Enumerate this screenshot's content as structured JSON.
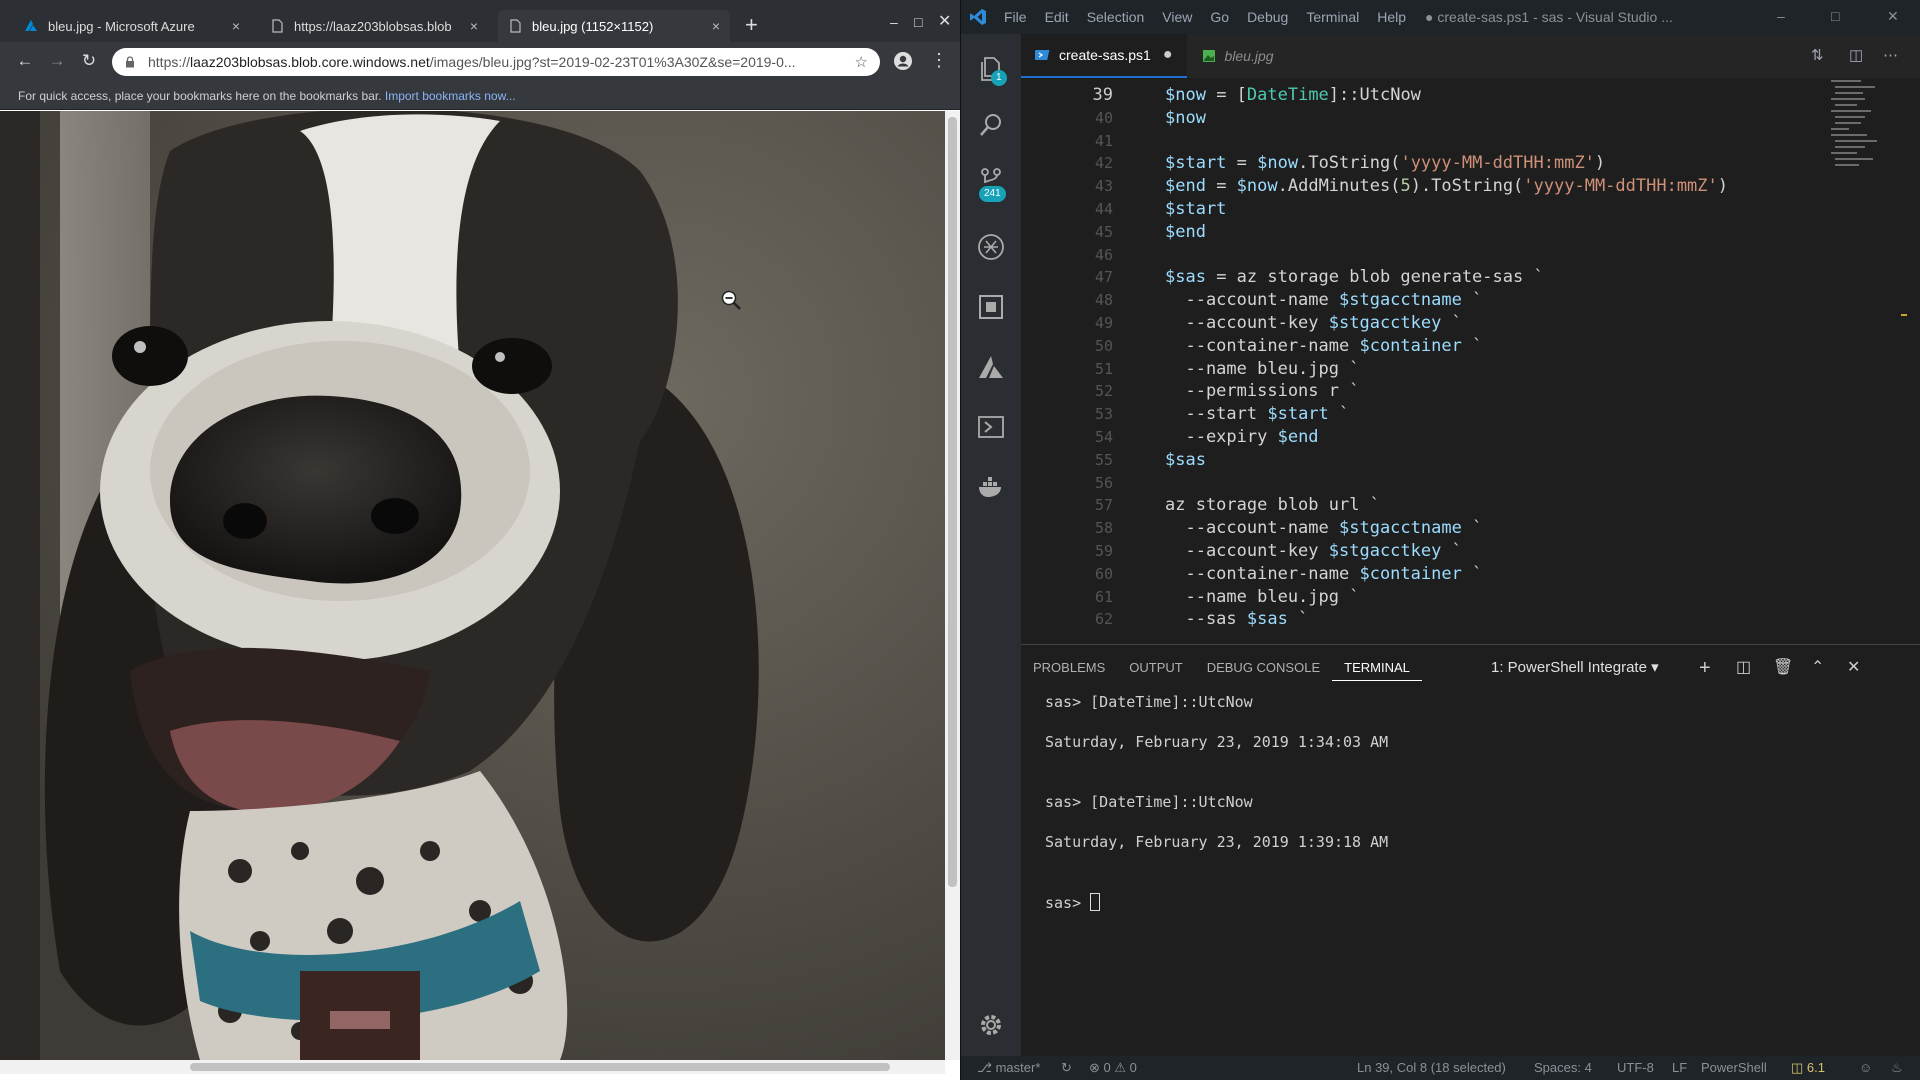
{
  "browser": {
    "tabs": [
      {
        "title": "bleu.jpg - Microsoft Azure"
      },
      {
        "title": "https://laaz203blobsas.blob"
      },
      {
        "title": "bleu.jpg (1152×1152)"
      }
    ],
    "new_tab_symbol": "+",
    "close_symbol": "×",
    "omnibox": {
      "url_prefix": "https://",
      "url_host": "laaz203blobsas.blob.core.windows.net",
      "url_path": "/images/bleu.jpg?st=2019-02-23T01%3A30Z&se=2019-0..."
    },
    "bookmarks_bar": {
      "hint": "For quick access, place your bookmarks here on the bookmarks bar.",
      "import_link": "Import bookmarks now..."
    }
  },
  "vscode": {
    "menu": [
      "File",
      "Edit",
      "Selection",
      "View",
      "Go",
      "Debug",
      "Terminal",
      "Help"
    ],
    "window_title": "● create-sas.ps1 - sas - Visual Studio ...",
    "badges": {
      "explorer": "1",
      "source_control": "241"
    },
    "editor_tabs": [
      {
        "label": "create-sas.ps1",
        "modified_dot": "●"
      },
      {
        "label": "bleu.jpg"
      }
    ],
    "code": {
      "current_line_number": "39",
      "lines": [
        {
          "ln": "39",
          "parts": [
            [
              "tv",
              "$now"
            ],
            [
              "tp",
              " = ["
            ],
            [
              "tt",
              "DateTime"
            ],
            [
              "tp",
              "]::UtcNow"
            ]
          ]
        },
        {
          "ln": "40",
          "parts": [
            [
              "tv",
              "$now"
            ]
          ]
        },
        {
          "ln": "41",
          "parts": []
        },
        {
          "ln": "42",
          "parts": [
            [
              "tv",
              "$start"
            ],
            [
              "tp",
              " = "
            ],
            [
              "tv",
              "$now"
            ],
            [
              "tp",
              ".ToString("
            ],
            [
              "ts",
              "'yyyy-MM-ddTHH:mmZ'"
            ],
            [
              "tp",
              ")"
            ]
          ]
        },
        {
          "ln": "43",
          "parts": [
            [
              "tv",
              "$end"
            ],
            [
              "tp",
              " = "
            ],
            [
              "tv",
              "$now"
            ],
            [
              "tp",
              ".AddMinutes("
            ],
            [
              "tn",
              "5"
            ],
            [
              "tp",
              ").ToString("
            ],
            [
              "ts",
              "'yyyy-MM-ddTHH:mmZ'"
            ],
            [
              "tp",
              ")"
            ]
          ]
        },
        {
          "ln": "44",
          "parts": [
            [
              "tv",
              "$start"
            ]
          ]
        },
        {
          "ln": "45",
          "parts": [
            [
              "tv",
              "$end"
            ]
          ]
        },
        {
          "ln": "46",
          "parts": []
        },
        {
          "ln": "47",
          "parts": [
            [
              "tv",
              "$sas"
            ],
            [
              "tp",
              " = az storage blob generate-sas `"
            ]
          ]
        },
        {
          "ln": "48",
          "parts": [
            [
              "tp",
              "  --account-name "
            ],
            [
              "tv",
              "$stgacctname"
            ],
            [
              "tp",
              " `"
            ]
          ]
        },
        {
          "ln": "49",
          "parts": [
            [
              "tp",
              "  --account-key "
            ],
            [
              "tv",
              "$stgacctkey"
            ],
            [
              "tp",
              " `"
            ]
          ]
        },
        {
          "ln": "50",
          "parts": [
            [
              "tp",
              "  --container-name "
            ],
            [
              "tv",
              "$container"
            ],
            [
              "tp",
              " `"
            ]
          ]
        },
        {
          "ln": "51",
          "parts": [
            [
              "tp",
              "  --name bleu.jpg `"
            ]
          ]
        },
        {
          "ln": "52",
          "parts": [
            [
              "tp",
              "  --permissions r `"
            ]
          ]
        },
        {
          "ln": "53",
          "parts": [
            [
              "tp",
              "  --start "
            ],
            [
              "tv",
              "$start"
            ],
            [
              "tp",
              " `"
            ]
          ]
        },
        {
          "ln": "54",
          "parts": [
            [
              "tp",
              "  --expiry "
            ],
            [
              "tv",
              "$end"
            ]
          ]
        },
        {
          "ln": "55",
          "parts": [
            [
              "tv",
              "$sas"
            ]
          ]
        },
        {
          "ln": "56",
          "parts": []
        },
        {
          "ln": "57",
          "parts": [
            [
              "tp",
              "az storage blob url `"
            ]
          ]
        },
        {
          "ln": "58",
          "parts": [
            [
              "tp",
              "  --account-name "
            ],
            [
              "tv",
              "$stgacctname"
            ],
            [
              "tp",
              " `"
            ]
          ]
        },
        {
          "ln": "59",
          "parts": [
            [
              "tp",
              "  --account-key "
            ],
            [
              "tv",
              "$stgacctkey"
            ],
            [
              "tp",
              " `"
            ]
          ]
        },
        {
          "ln": "60",
          "parts": [
            [
              "tp",
              "  --container-name "
            ],
            [
              "tv",
              "$container"
            ],
            [
              "tp",
              " `"
            ]
          ]
        },
        {
          "ln": "61",
          "parts": [
            [
              "tp",
              "  --name bleu.jpg `"
            ]
          ]
        },
        {
          "ln": "62",
          "parts": [
            [
              "tp",
              "  --sas "
            ],
            [
              "tv",
              "$sas"
            ],
            [
              "tp",
              " `"
            ]
          ]
        }
      ]
    },
    "panel": {
      "tabs": [
        "PROBLEMS",
        "OUTPUT",
        "DEBUG CONSOLE",
        "TERMINAL"
      ],
      "terminal_select": "1: PowerShell Integrate ▾",
      "terminal_lines": [
        "sas> [DateTime]::UtcNow",
        "Saturday, February 23, 2019 1:34:03 AM",
        "sas> [DateTime]::UtcNow",
        "Saturday, February 23, 2019 1:39:18 AM",
        "sas> "
      ]
    },
    "status": {
      "branch": "master*",
      "problems": "⊗ 0 ⚠ 0",
      "position": "Ln 39, Col 8 (18 selected)",
      "spaces": "Spaces: 4",
      "encoding": "UTF-8",
      "eol": "LF",
      "language": "PowerShell",
      "ps_version": "6.1"
    }
  }
}
